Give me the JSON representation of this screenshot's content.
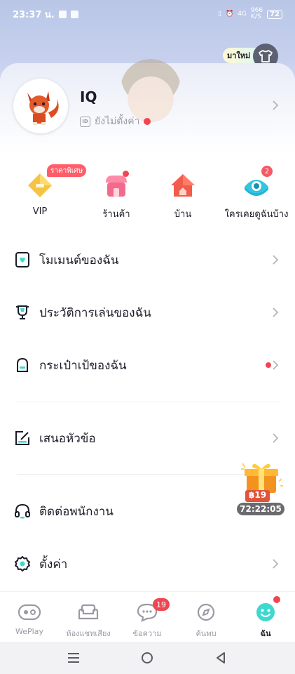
{
  "status_bar": {
    "time": "23:37 น.",
    "network": "4G",
    "speed_value": "966",
    "speed_unit": "K/S",
    "battery": "72"
  },
  "header": {
    "new_label": "มาใหม่"
  },
  "profile": {
    "username": "IQ",
    "id_label": "ID",
    "id_status": "ยังไม่ตั้งค่า"
  },
  "shortcuts": [
    {
      "label": "VIP",
      "badge": "ราคาพิเศษ"
    },
    {
      "label": "ร้านค้า"
    },
    {
      "label": "บ้าน"
    },
    {
      "label": "ใครเคยดูฉันบ้าง",
      "badge": "2"
    }
  ],
  "menu": [
    {
      "label": "โมเมนต์ของฉัน"
    },
    {
      "label": "ประวัติการเล่นของฉัน"
    },
    {
      "label": "กระเป๋าเป้ของฉัน"
    },
    {
      "label": "เสนอหัวข้อ"
    },
    {
      "label": "ติดต่อพนักงาน"
    },
    {
      "label": "ตั้งค่า"
    }
  ],
  "gift": {
    "price": "฿19",
    "timer": "72:22:05"
  },
  "tabs": [
    {
      "label": "WePlay"
    },
    {
      "label": "ห้องแชทเสียง"
    },
    {
      "label": "ข้อความ",
      "badge": "19"
    },
    {
      "label": "ค้นพบ"
    },
    {
      "label": "ฉัน"
    }
  ],
  "colors": {
    "accent": "#3dd9d0",
    "badge_red": "#f24552",
    "text": "#1c1c28",
    "muted": "#9a9aa6"
  }
}
